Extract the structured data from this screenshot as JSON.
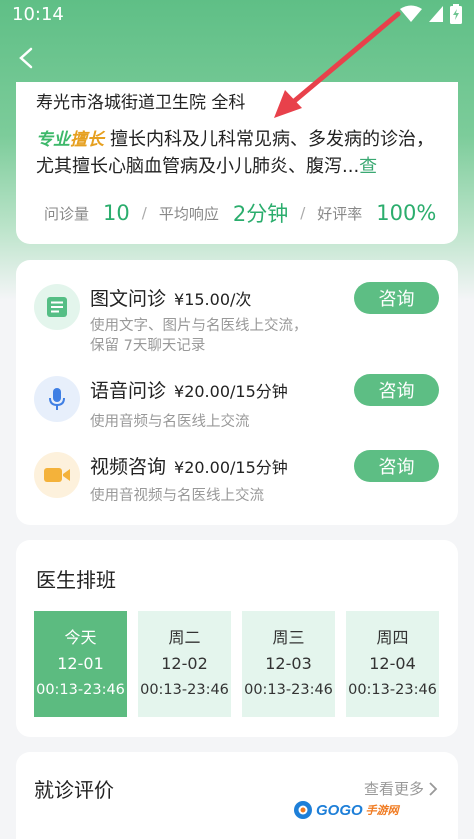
{
  "status_bar": {
    "time": "10:14"
  },
  "doctor": {
    "hospital": "寿光市洛城街道卫生院 全科",
    "specialty_tag_1": "专业",
    "specialty_tag_2": "擅长",
    "specialty_text": "擅长内科及儿科常见病、多发病的诊治，尤其擅长心脑血管病及小儿肺炎、腹泻...",
    "specialty_more": "查",
    "stats": [
      {
        "label": "问诊量",
        "value": "10"
      },
      {
        "label": "平均响应",
        "value": "2分钟"
      },
      {
        "label": "好评率",
        "value": "100%"
      }
    ]
  },
  "consult": [
    {
      "title": "图文问诊",
      "price": "¥15.00/次",
      "desc": "使用文字、图片与名医线上交流，保留 7天聊天记录",
      "button": "咨询",
      "icon": "document-icon",
      "icon_bg": "#e3f5ec",
      "icon_color": "#55be85"
    },
    {
      "title": "语音问诊",
      "price": "¥20.00/15分钟",
      "desc": "使用音频与名医线上交流",
      "button": "咨询",
      "icon": "microphone-icon",
      "icon_bg": "#e7effb",
      "icon_color": "#3f7fe4"
    },
    {
      "title": "视频咨询",
      "price": "¥20.00/15分钟",
      "desc": "使用音视频与名医线上交流",
      "button": "咨询",
      "icon": "video-camera-icon",
      "icon_bg": "#fdf1dc",
      "icon_color": "#f4b23a"
    }
  ],
  "schedule": {
    "title": "医生排班",
    "days": [
      {
        "day": "今天",
        "date": "12-01",
        "time": "00:13-23:46",
        "active": true
      },
      {
        "day": "周二",
        "date": "12-02",
        "time": "00:13-23:46",
        "active": false
      },
      {
        "day": "周三",
        "date": "12-03",
        "time": "00:13-23:46",
        "active": false
      },
      {
        "day": "周四",
        "date": "12-04",
        "time": "00:13-23:46",
        "active": false
      }
    ]
  },
  "reviews": {
    "title": "就诊评价",
    "more": "查看更多"
  },
  "watermark": {
    "brand": "GOGO",
    "suffix": "手游网"
  },
  "colors": {
    "accent": "#5dbe84",
    "stat_value": "#2bad6d",
    "annotation_arrow": "#e8414b"
  }
}
